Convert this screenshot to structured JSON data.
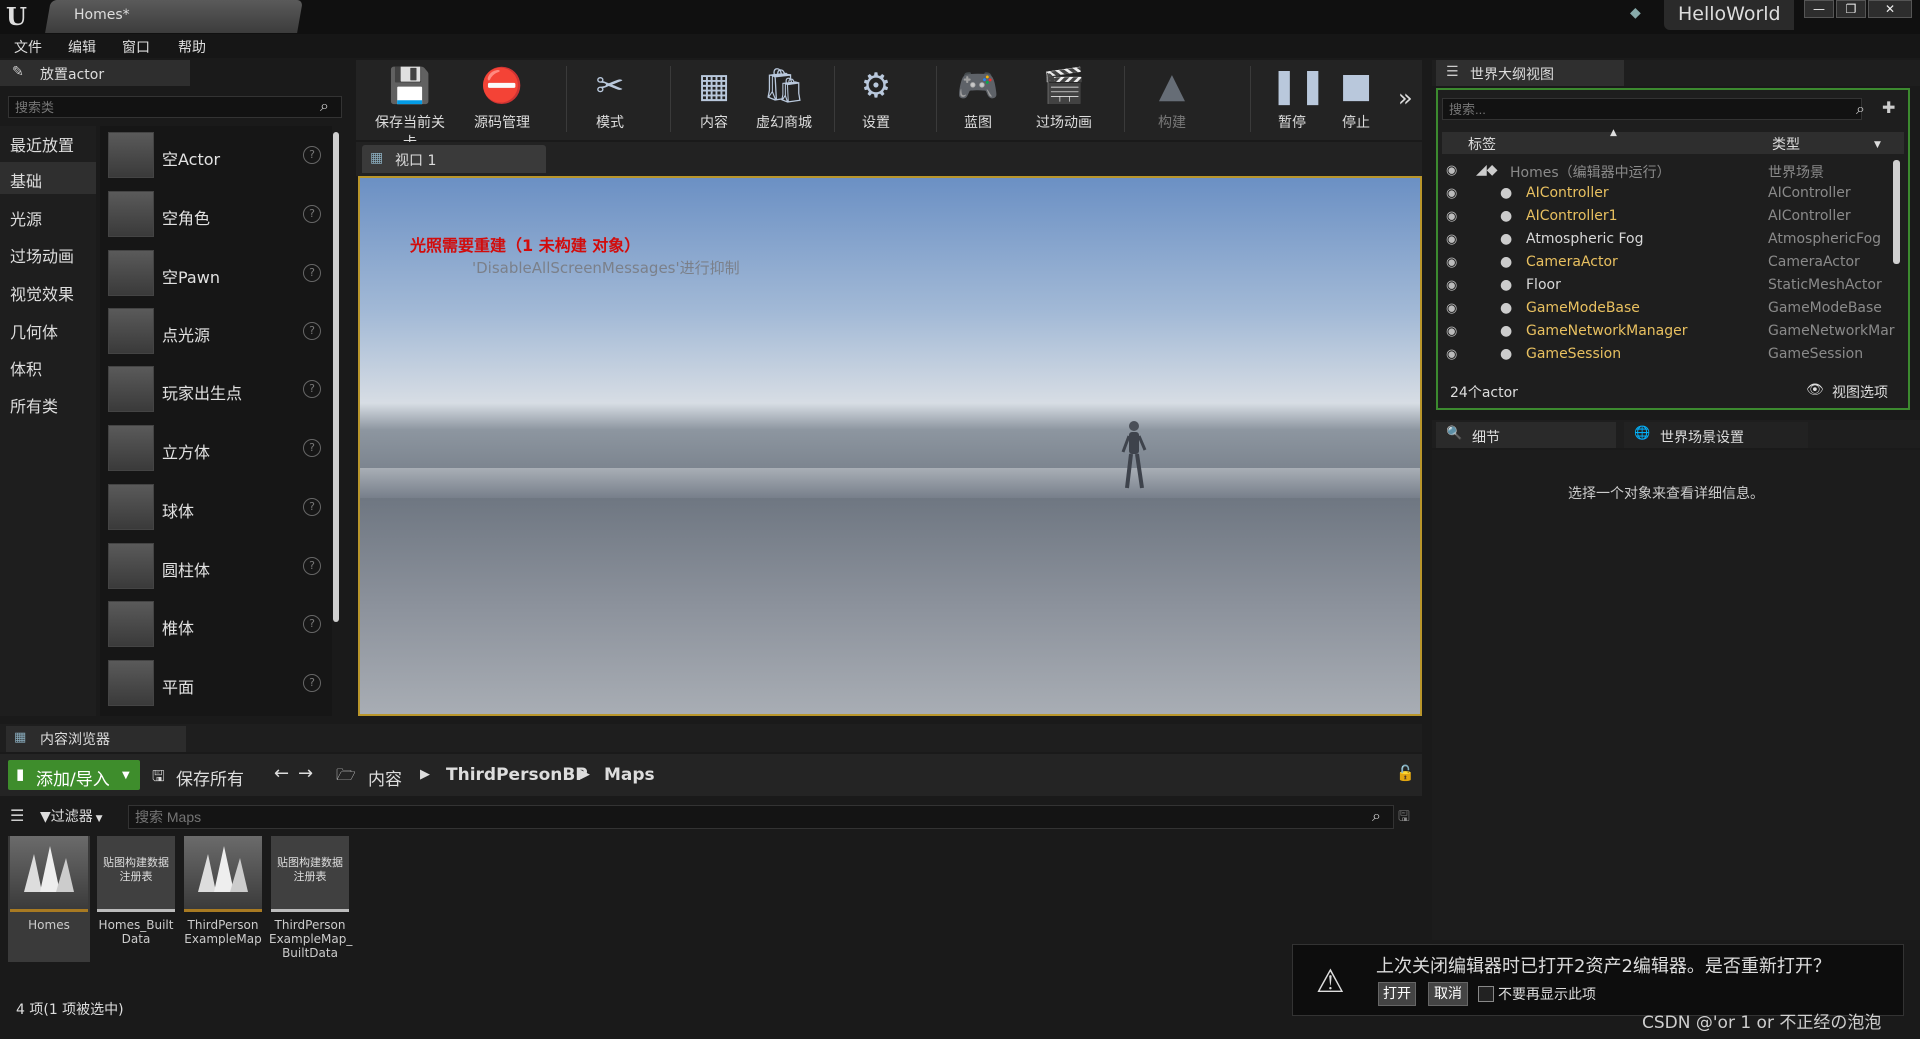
{
  "window": {
    "tab_title": "Homes*",
    "project_name": "HelloWorld",
    "controls": {
      "minimize": "—",
      "restore": "❐",
      "close": "✕"
    }
  },
  "menu": [
    "文件",
    "编辑",
    "窗口",
    "帮助"
  ],
  "place_actor": {
    "title": "放置actor",
    "search_placeholder": "搜索类",
    "categories": [
      "最近放置",
      "基础",
      "光源",
      "过场动画",
      "视觉效果",
      "几何体",
      "体积",
      "所有类"
    ],
    "selected_category": "基础",
    "actors": [
      "空Actor",
      "空角色",
      "空Pawn",
      "点光源",
      "玩家出生点",
      "立方体",
      "球体",
      "圆柱体",
      "椎体",
      "平面"
    ],
    "help_glyph": "?"
  },
  "toolbar": {
    "items": [
      {
        "label": "保存当前关卡",
        "icon": "save-level-icon"
      },
      {
        "label": "源码管理",
        "icon": "source-control-icon"
      },
      {
        "label": "模式",
        "icon": "modes-icon"
      },
      {
        "label": "内容",
        "icon": "content-icon"
      },
      {
        "label": "虚幻商城",
        "icon": "marketplace-icon"
      },
      {
        "label": "设置",
        "icon": "settings-icon"
      },
      {
        "label": "蓝图",
        "icon": "blueprint-icon"
      },
      {
        "label": "过场动画",
        "icon": "cinematics-icon"
      },
      {
        "label": "构建",
        "icon": "build-icon"
      },
      {
        "label": "暂停",
        "icon": "pause-icon"
      },
      {
        "label": "停止",
        "icon": "stop-icon"
      }
    ],
    "more": "»"
  },
  "viewport": {
    "tab_label": "视口 1",
    "message_error": "光照需要重建（1 未构建 对象）",
    "message_hint": "'DisableAllScreenMessages'进行抑制"
  },
  "outliner": {
    "title": "世界大纲视图",
    "search_placeholder": "搜索...",
    "col_label": "标签",
    "col_type": "类型",
    "rows": [
      {
        "label": "Homes（编辑器中运行）",
        "type": "世界场景",
        "color": "#8a8a8a"
      },
      {
        "label": "AIController",
        "type": "AIController",
        "color": "#e8c060"
      },
      {
        "label": "AIController1",
        "type": "AIController",
        "color": "#e8c060"
      },
      {
        "label": "Atmospheric Fog",
        "type": "AtmosphericFog",
        "color": "#d8d8d8"
      },
      {
        "label": "CameraActor",
        "type": "CameraActor",
        "color": "#e8c060"
      },
      {
        "label": "Floor",
        "type": "StaticMeshActor",
        "color": "#d8d8d8"
      },
      {
        "label": "GameModeBase",
        "type": "GameModeBase",
        "color": "#e8c060"
      },
      {
        "label": "GameNetworkManager",
        "type": "GameNetworkMar",
        "color": "#e8c060"
      },
      {
        "label": "GameSession",
        "type": "GameSession",
        "color": "#e8c060"
      }
    ],
    "count": "24个actor",
    "view_options": "视图选项"
  },
  "details": {
    "tab_details": "细节",
    "tab_world": "世界场景设置",
    "empty_message": "选择一个对象来查看详细信息。"
  },
  "content_browser": {
    "title": "内容浏览器",
    "add_import": "添加/导入",
    "save_all": "保存所有",
    "breadcrumbs": [
      "内容",
      "ThirdPersonBP",
      "Maps"
    ],
    "filter": "过滤器",
    "search_placeholder": "搜索 Maps",
    "assets": [
      {
        "name": "Homes",
        "thumb": "map",
        "thumb_text": ""
      },
      {
        "name": "Homes_Built Data",
        "thumb": "data",
        "thumb_text": "贴图构建数据注册表"
      },
      {
        "name": "ThirdPerson ExampleMap",
        "thumb": "map",
        "thumb_text": ""
      },
      {
        "name": "ThirdPerson ExampleMap_ BuiltData",
        "thumb": "data",
        "thumb_text": "贴图构建数据注册表"
      }
    ],
    "status": "4 项(1 项被选中)"
  },
  "notification": {
    "message": "上次关闭编辑器时已打开2资产2编辑器。是否重新打开？",
    "open": "打开",
    "cancel": "取消",
    "dont_show": "不要再显示此项"
  },
  "watermark": "CSDN @'or 1 or 不正经の泡泡"
}
